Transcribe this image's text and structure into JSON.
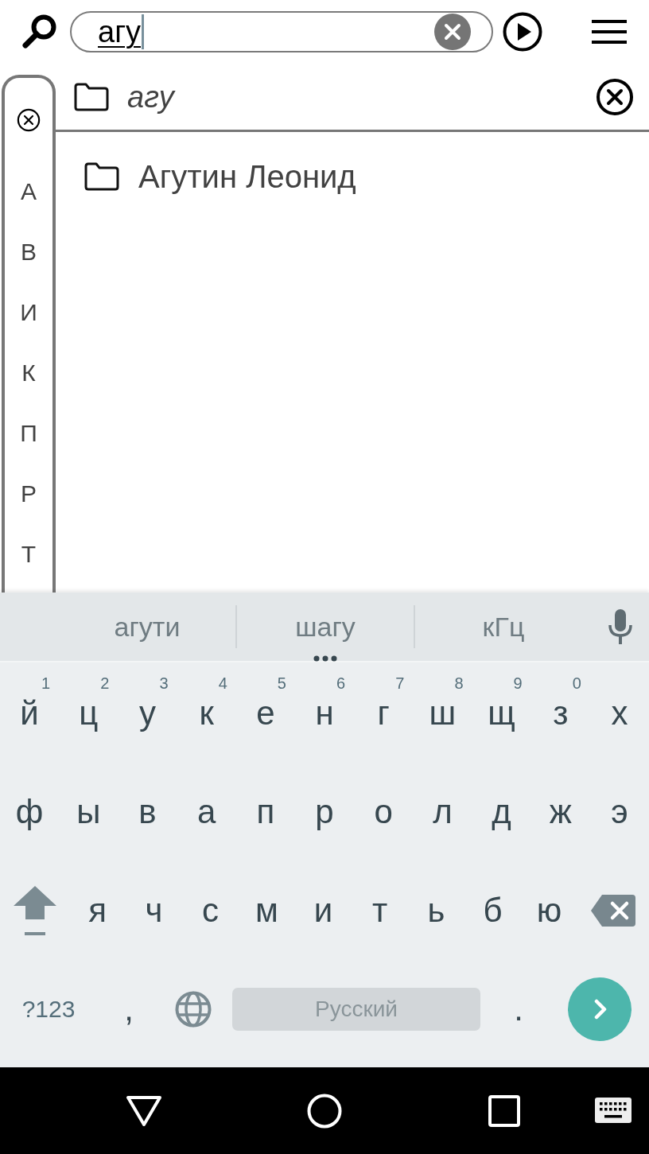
{
  "search_bar": {
    "query": "агу",
    "composing": true
  },
  "index_sidebar": {
    "letters": [
      "А",
      "В",
      "И",
      "К",
      "П",
      "Р",
      "Т"
    ]
  },
  "filter_row": {
    "label": "агу"
  },
  "results": [
    {
      "name": "Агутин Леонид"
    }
  ],
  "keyboard": {
    "suggestions": [
      {
        "text": "агути",
        "more": false
      },
      {
        "text": "шагу",
        "more": true
      },
      {
        "text": "кГц",
        "more": false
      }
    ],
    "rows": [
      {
        "keys": [
          {
            "kind": "letter",
            "label": "й",
            "hint": "1"
          },
          {
            "kind": "letter",
            "label": "ц",
            "hint": "2"
          },
          {
            "kind": "letter",
            "label": "у",
            "hint": "3"
          },
          {
            "kind": "letter",
            "label": "к",
            "hint": "4"
          },
          {
            "kind": "letter",
            "label": "е",
            "hint": "5"
          },
          {
            "kind": "letter",
            "label": "н",
            "hint": "6"
          },
          {
            "kind": "letter",
            "label": "г",
            "hint": "7"
          },
          {
            "kind": "letter",
            "label": "ш",
            "hint": "8"
          },
          {
            "kind": "letter",
            "label": "щ",
            "hint": "9"
          },
          {
            "kind": "letter",
            "label": "з",
            "hint": "0"
          },
          {
            "kind": "letter",
            "label": "х"
          }
        ]
      },
      {
        "keys": [
          {
            "kind": "letter",
            "label": "ф"
          },
          {
            "kind": "letter",
            "label": "ы"
          },
          {
            "kind": "letter",
            "label": "в"
          },
          {
            "kind": "letter",
            "label": "а"
          },
          {
            "kind": "letter",
            "label": "п"
          },
          {
            "kind": "letter",
            "label": "р"
          },
          {
            "kind": "letter",
            "label": "о"
          },
          {
            "kind": "letter",
            "label": "л"
          },
          {
            "kind": "letter",
            "label": "д"
          },
          {
            "kind": "letter",
            "label": "ж"
          },
          {
            "kind": "letter",
            "label": "э"
          }
        ]
      },
      {
        "keys": [
          {
            "kind": "shift"
          },
          {
            "kind": "letter",
            "label": "я"
          },
          {
            "kind": "letter",
            "label": "ч"
          },
          {
            "kind": "letter",
            "label": "с"
          },
          {
            "kind": "letter",
            "label": "м"
          },
          {
            "kind": "letter",
            "label": "и"
          },
          {
            "kind": "letter",
            "label": "т"
          },
          {
            "kind": "letter",
            "label": "ь"
          },
          {
            "kind": "letter",
            "label": "б"
          },
          {
            "kind": "letter",
            "label": "ю"
          },
          {
            "kind": "backspace"
          }
        ]
      },
      {
        "keys": [
          {
            "kind": "symbols",
            "label": "?123"
          },
          {
            "kind": "punctuation",
            "label": ","
          },
          {
            "kind": "globe"
          },
          {
            "kind": "space",
            "label": "Русский"
          },
          {
            "kind": "punctuation",
            "label": "."
          },
          {
            "kind": "enter"
          }
        ]
      }
    ]
  }
}
